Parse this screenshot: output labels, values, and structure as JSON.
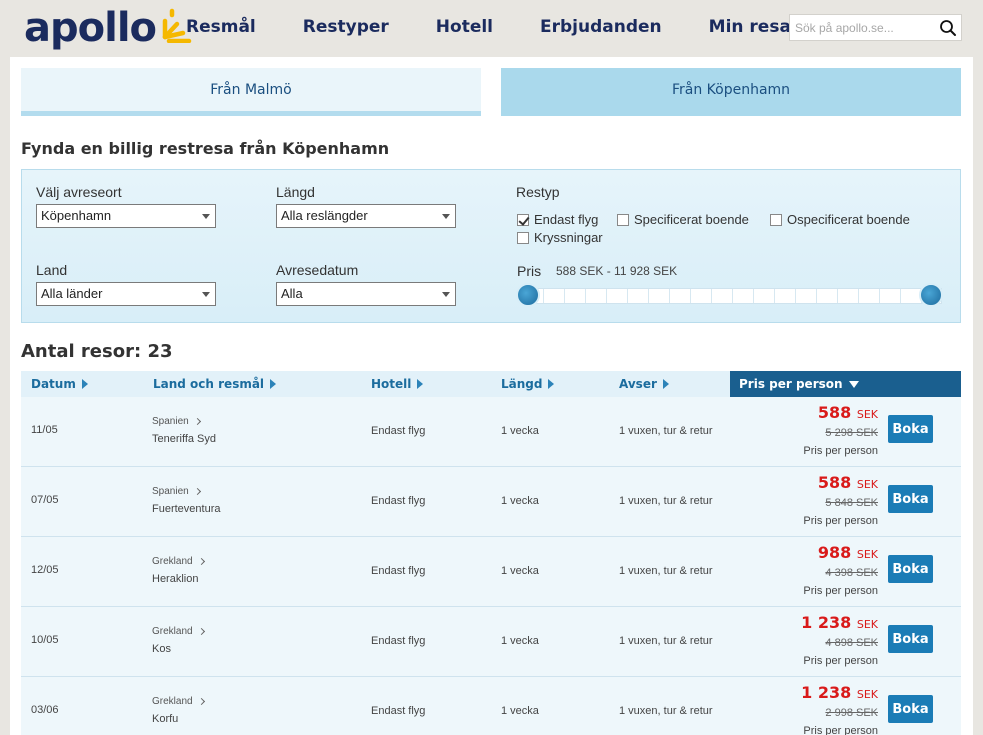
{
  "header": {
    "logo_text": "apollo",
    "nav": [
      "Resmål",
      "Restyper",
      "Hotell",
      "Erbjudanden",
      "Min resa"
    ],
    "search_placeholder": "Sök på apollo.se..."
  },
  "tabs": {
    "malmo": "Från Malmö",
    "kph": "Från Köpenhamn",
    "active": "kph"
  },
  "title": "Fynda en billig restresa från Köpenhamn",
  "filters": {
    "departure_label": "Välj avreseort",
    "departure_value": "Köpenhamn",
    "length_label": "Längd",
    "length_value": "Alla reslängder",
    "country_label": "Land",
    "country_value": "Alla länder",
    "date_label": "Avresedatum",
    "date_value": "Alla",
    "type_label": "Restyp",
    "types": [
      {
        "label": "Endast flyg",
        "checked": true
      },
      {
        "label": "Specificerat boende",
        "checked": false
      },
      {
        "label": "Ospecificerat boende",
        "checked": false
      },
      {
        "label": "Kryssningar",
        "checked": false
      }
    ],
    "price_label": "Pris",
    "price_range": "588 SEK - 11 928 SEK"
  },
  "count_text": "Antal resor: 23",
  "table": {
    "headers": {
      "date": "Datum",
      "destination": "Land och resmål",
      "hotel": "Hotell",
      "length": "Längd",
      "for": "Avser",
      "price": "Pris per person"
    },
    "rows": [
      {
        "date": "11/05",
        "country": "Spanien",
        "city": "Teneriffa Syd",
        "hotel": "Endast flyg",
        "length": "1 vecka",
        "for": "1 vuxen, tur & retur",
        "price": "588",
        "currency": "SEK",
        "old_price": "5 298 SEK",
        "per_person": "Pris per person",
        "button": "Boka"
      },
      {
        "date": "07/05",
        "country": "Spanien",
        "city": "Fuerteventura",
        "hotel": "Endast flyg",
        "length": "1 vecka",
        "for": "1 vuxen, tur & retur",
        "price": "588",
        "currency": "SEK",
        "old_price": "5 848 SEK",
        "per_person": "Pris per person",
        "button": "Boka"
      },
      {
        "date": "12/05",
        "country": "Grekland",
        "city": "Heraklion",
        "hotel": "Endast flyg",
        "length": "1 vecka",
        "for": "1 vuxen, tur & retur",
        "price": "988",
        "currency": "SEK",
        "old_price": "4 398 SEK",
        "per_person": "Pris per person",
        "button": "Boka"
      },
      {
        "date": "10/05",
        "country": "Grekland",
        "city": "Kos",
        "hotel": "Endast flyg",
        "length": "1 vecka",
        "for": "1 vuxen, tur & retur",
        "price": "1 238",
        "currency": "SEK",
        "old_price": "4 898 SEK",
        "per_person": "Pris per person",
        "button": "Boka"
      },
      {
        "date": "03/06",
        "country": "Grekland",
        "city": "Korfu",
        "hotel": "Endast flyg",
        "length": "1 vecka",
        "for": "1 vuxen, tur & retur",
        "price": "1 238",
        "currency": "SEK",
        "old_price": "2 998 SEK",
        "per_person": "Pris per person",
        "button": "Boka"
      }
    ]
  },
  "colors": {
    "navy": "#1b2b5e",
    "accent_blue": "#1b7cb6",
    "price_red": "#d91a1a",
    "logo_yellow": "#f5b800"
  }
}
